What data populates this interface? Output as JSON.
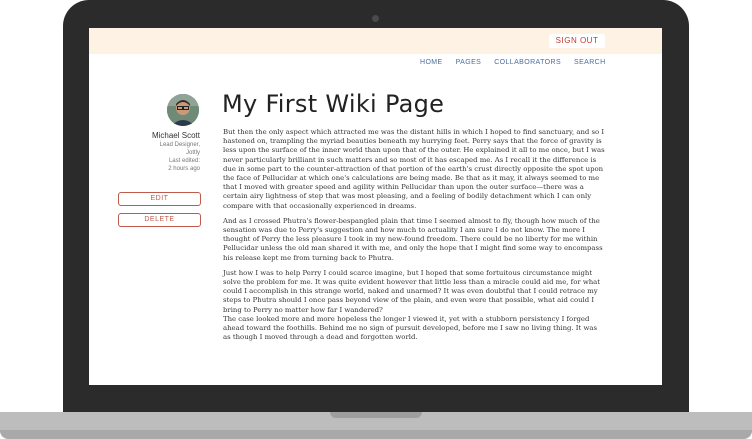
{
  "topbar": {
    "signout_label": "SIGN OUT"
  },
  "nav": [
    "HOME",
    "PAGES",
    "COLLABORATORS",
    "SEARCH"
  ],
  "author": {
    "name": "Michael Scott",
    "role": "Lead Designer,",
    "company": "Jottly",
    "edited_label": "Last edited:",
    "edited_time": "2 hours ago"
  },
  "actions": {
    "edit_label": "EDIT",
    "delete_label": "DELETE"
  },
  "page": {
    "title": "My First Wiki Page",
    "paragraphs": [
      "But then the only aspect which attracted me was the distant hills in which I hoped to find sanctuary, and so I hastened on, trampling the myriad beauties beneath my hurrying feet. Perry says that the force of gravity is less upon the surface of the inner world than upon that of the outer. He explained it all to me once, but I was never particularly brilliant in such matters and so most of it has escaped me. As I recall it the difference is due in some part to the counter-attraction of that portion of the earth's crust directly opposite the spot upon the face of Pellucidar at which one's calculations are being made. Be that as it may, it always seemed to me that I moved with greater speed and agility within Pellucidar than upon the outer surface—there was a certain airy lightness of step that was most pleasing, and a feeling of bodily detachment which I can only compare with that occasionally experienced in dreams.",
      "And as I crossed Phutra's flower-bespangled plain that time I seemed almost to fly, though how much of the sensation was due to Perry's suggestion and how much to actuality I am sure I do not know. The more I thought of Perry the less pleasure I took in my new-found freedom. There could be no liberty for me within Pellucidar unless the old man shared it with me, and only the hope that I might find some way to encompass his release kept me from turning back to Phutra.",
      "Just how I was to help Perry I could scarce imagine, but I hoped that some fortuitous circumstance might solve the problem for me. It was quite evident however that little less than a miracle could aid me, for what could I accomplish in this strange world, naked and unarmed? It was even doubtful that I could retrace my steps to Phutra should I once pass beyond view of the plain, and even were that possible, what aid could I bring to Perry no matter how far I wandered?",
      "The case looked more and more hopeless the longer I viewed it, yet with a stubborn persistency I forged ahead toward the foothills. Behind me no sign of pursuit developed, before me I saw no living thing. It was as though I moved through a dead and forgotten world."
    ]
  }
}
